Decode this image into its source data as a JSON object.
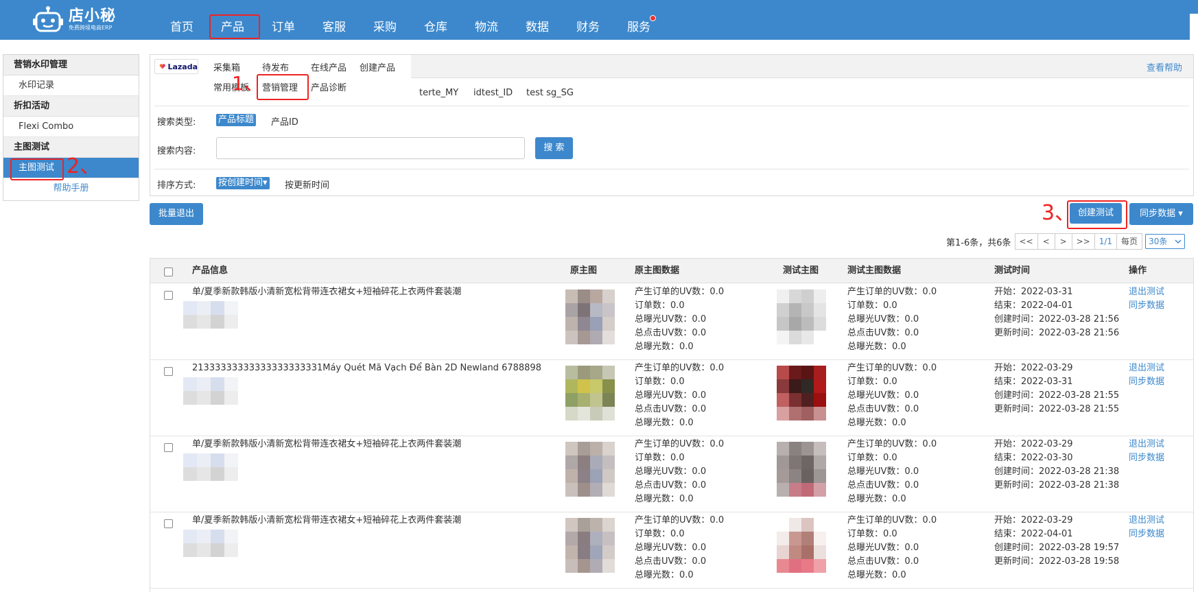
{
  "brand": {
    "name": "店小秘",
    "slogan": "免费跨境电商ERP"
  },
  "nav": [
    {
      "label": "首页"
    },
    {
      "label": "产品"
    },
    {
      "label": "订单"
    },
    {
      "label": "客服"
    },
    {
      "label": "采购"
    },
    {
      "label": "仓库"
    },
    {
      "label": "物流"
    },
    {
      "label": "数据"
    },
    {
      "label": "财务"
    },
    {
      "label": "服务"
    }
  ],
  "sidebar": {
    "groups": [
      {
        "title": "营销水印管理",
        "items": [
          {
            "label": "水印记录"
          }
        ]
      },
      {
        "title": "折扣活动",
        "items": [
          {
            "label": "Flexi Combo"
          }
        ]
      },
      {
        "title": "主图测试",
        "items": [
          {
            "label": "主图测试"
          }
        ]
      }
    ],
    "help": "帮助手册"
  },
  "annotations": {
    "step1": "1、",
    "step2": "2、",
    "step3": "3、"
  },
  "platform": {
    "logo_text": "Lazada"
  },
  "subnav": {
    "row1": [
      "采集箱",
      "待发布",
      "在线产品",
      "创建产品"
    ],
    "row2": [
      "常用模板",
      "营销管理",
      "产品诊断"
    ]
  },
  "help_link": "查看帮助",
  "shops": [
    "terte_MY",
    "idtest_ID",
    "test sg_SG"
  ],
  "filters": {
    "search_type_label": "搜索类型:",
    "search_type_active": "产品标题",
    "search_type_other": "产品ID",
    "search_content_label": "搜索内容:",
    "search_value": "",
    "search_button": "搜 索",
    "sort_label": "排序方式:",
    "sort_active": "按创建时间▾",
    "sort_other": "按更新时间"
  },
  "actions": {
    "batch_exit": "批量退出",
    "create_test": "创建测试",
    "sync_data": "同步数据 ▾"
  },
  "pager": {
    "summary": "第1-6条，共6条",
    "first": "<<",
    "prev": "<",
    "next": ">",
    "last": ">>",
    "current": "1/1",
    "per_page_label": "每页",
    "per_page": "30条"
  },
  "table": {
    "headers": [
      "产品信息",
      "原主图",
      "原主图数据",
      "测试主图",
      "测试主图数据",
      "测试时间",
      "操作"
    ],
    "metric_labels": [
      "产生订单的UV数：",
      "订单数：",
      "总曝光UV数：",
      "总点击UV数：",
      "总曝光数："
    ],
    "time_labels": [
      "开始：",
      "结束：",
      "创建时间：",
      "更新时间："
    ],
    "row_actions": [
      "退出测试",
      "同步数据"
    ],
    "rows": [
      {
        "title": "单/夏季新款韩版小清新宽松背带连衣裙女+短袖碎花上衣两件套装潮",
        "orig_metrics": [
          "0.0",
          "0.0",
          "0.0",
          "0.0",
          "0.0"
        ],
        "test_metrics": [
          "0.0",
          "0.0",
          "0.0",
          "0.0",
          "0.0"
        ],
        "times": [
          "2022-03-31",
          "2022-04-01",
          "2022-03-28 21:56",
          "2022-03-28 21:56"
        ]
      },
      {
        "title": "21333333333333333333331Máy Quét Mã Vạch Để Bàn 2D Newland 6788898",
        "orig_metrics": [
          "0.0",
          "0.0",
          "0.0",
          "0.0",
          "0.0"
        ],
        "test_metrics": [
          "0.0",
          "0.0",
          "0.0",
          "0.0",
          "0.0"
        ],
        "times": [
          "2022-03-29",
          "2022-03-31",
          "2022-03-28 21:55",
          "2022-03-28 21:55"
        ]
      },
      {
        "title": "单/夏季新款韩版小清新宽松背带连衣裙女+短袖碎花上衣两件套装潮",
        "orig_metrics": [
          "0.0",
          "0.0",
          "0.0",
          "0.0",
          "0.0"
        ],
        "test_metrics": [
          "0.0",
          "0.0",
          "0.0",
          "0.0",
          "0.0"
        ],
        "times": [
          "2022-03-29",
          "2022-03-30",
          "2022-03-28 21:38",
          "2022-03-28 21:38"
        ]
      },
      {
        "title": "单/夏季新款韩版小清新宽松背带连衣裙女+短袖碎花上衣两件套装潮",
        "orig_metrics": [
          "0.0",
          "0.0",
          "0.0",
          "0.0",
          "0.0"
        ],
        "test_metrics": [
          "0.0",
          "0.0",
          "0.0",
          "0.0",
          "0.0"
        ],
        "times": [
          "2022-03-29",
          "2022-04-01",
          "2022-03-28 19:57",
          "2022-03-28 19:58"
        ]
      }
    ]
  },
  "colors": {
    "primary": "#3d88cc",
    "annotation": "#ee2222"
  }
}
